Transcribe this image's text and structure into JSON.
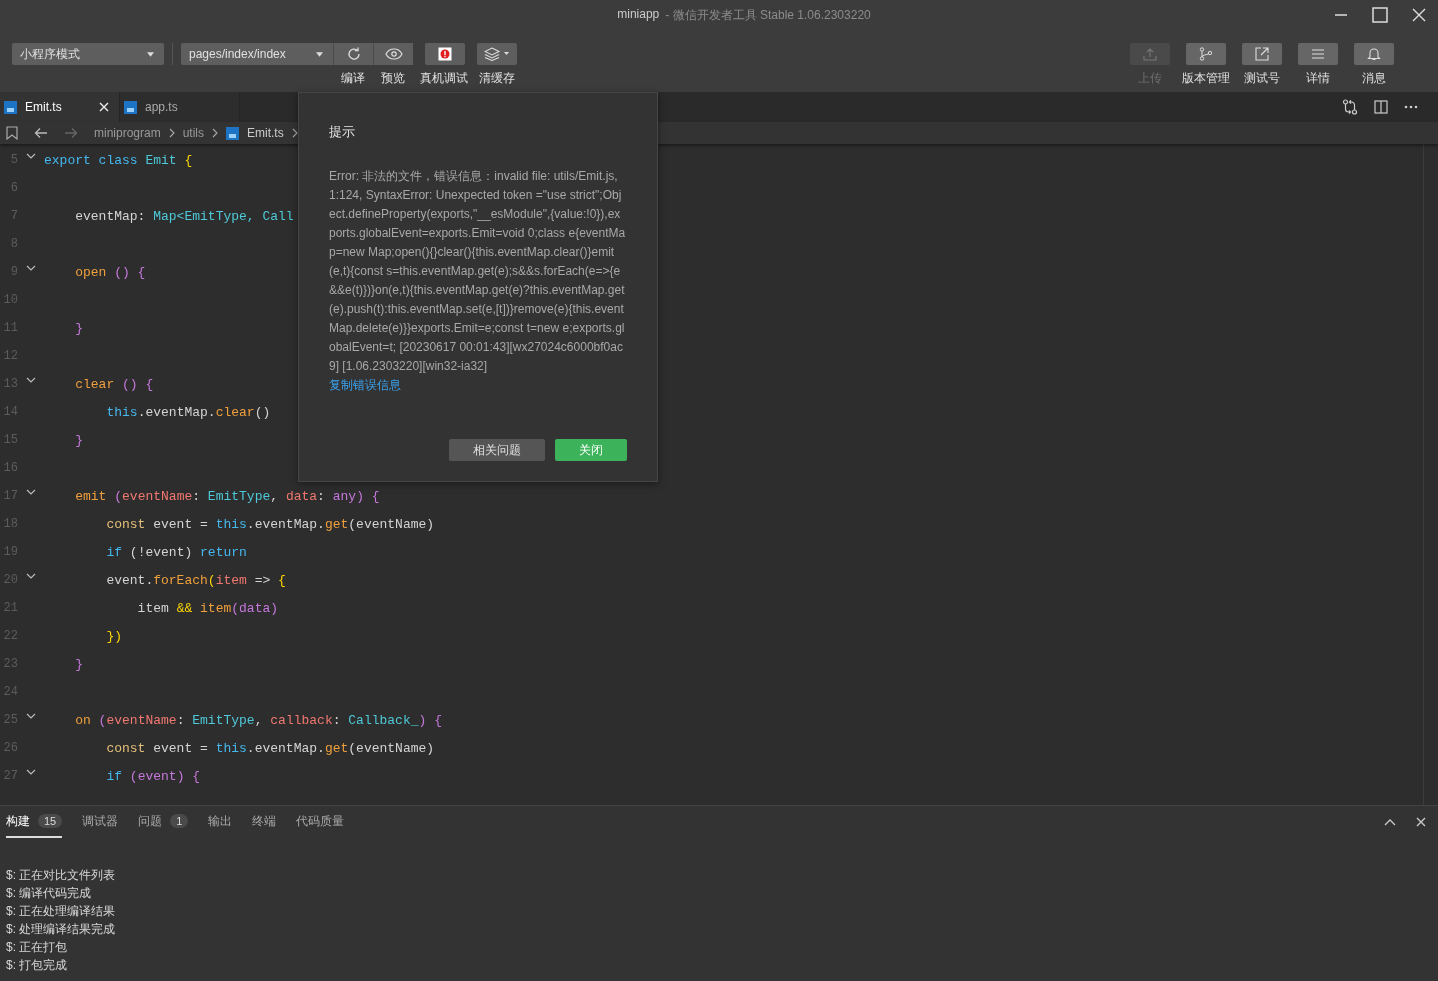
{
  "window": {
    "title": "miniapp",
    "subtitle": "- 微信开发者工具 Stable 1.06.2303220"
  },
  "toolbar": {
    "mode_select": "小程序模式",
    "page_select": "pages/index/index",
    "left_buttons": [
      {
        "label": "编译"
      },
      {
        "label": "预览"
      },
      {
        "label": "真机调试"
      },
      {
        "label": "清缓存"
      }
    ],
    "right_buttons": [
      {
        "label": "上传",
        "disabled": true
      },
      {
        "label": "版本管理",
        "disabled": false
      },
      {
        "label": "测试号",
        "disabled": false
      },
      {
        "label": "详情",
        "disabled": false
      },
      {
        "label": "消息",
        "disabled": false
      }
    ]
  },
  "editor_tabs": [
    {
      "label": "Emit.ts",
      "selected": true
    },
    {
      "label": "app.ts",
      "selected": false
    }
  ],
  "breadcrumb": [
    {
      "label": "miniprogram",
      "kind": "folder"
    },
    {
      "label": "utils",
      "kind": "folder"
    },
    {
      "label": "Emit.ts",
      "kind": "file"
    }
  ],
  "code_lines": [
    {
      "number": "5",
      "foldable": true,
      "tokens": [
        {
          "text": "export class ",
          "kind": "keyword"
        },
        {
          "text": "Emit ",
          "kind": "type"
        },
        {
          "text": "{",
          "kind": "bracket"
        }
      ]
    },
    {
      "number": "6",
      "foldable": false
    },
    {
      "number": "7",
      "foldable": false,
      "tokens": [
        {
          "text": "    eventMap: ",
          "kind": "plain"
        },
        {
          "text": "Map<EmitType, Call",
          "kind": "type"
        }
      ]
    },
    {
      "number": "8",
      "foldable": false
    },
    {
      "number": "9",
      "foldable": true,
      "tokens": [
        {
          "text": "    open ",
          "kind": "function"
        },
        {
          "text": "() {",
          "kind": "paren"
        }
      ]
    },
    {
      "number": "10",
      "foldable": false
    },
    {
      "number": "11",
      "foldable": false,
      "tokens": [
        {
          "text": "    }",
          "kind": "paren"
        }
      ]
    },
    {
      "number": "12",
      "foldable": false
    },
    {
      "number": "13",
      "foldable": true,
      "tokens": [
        {
          "text": "    clear ",
          "kind": "function"
        },
        {
          "text": "() {",
          "kind": "paren"
        }
      ]
    },
    {
      "number": "14",
      "foldable": false,
      "tokens": [
        {
          "text": "        this",
          "kind": "keyword"
        },
        {
          "text": ".eventMap.",
          "kind": "plain"
        },
        {
          "text": "clear",
          "kind": "function"
        },
        {
          "text": "()",
          "kind": "plain"
        }
      ]
    },
    {
      "number": "15",
      "foldable": false,
      "tokens": [
        {
          "text": "    }",
          "kind": "paren"
        }
      ]
    },
    {
      "number": "16",
      "foldable": false
    },
    {
      "number": "17",
      "foldable": true,
      "tokens": [
        {
          "text": "    emit ",
          "kind": "function"
        },
        {
          "text": "(",
          "kind": "paren"
        },
        {
          "text": "eventName",
          "kind": "param"
        },
        {
          "text": ": ",
          "kind": "plain"
        },
        {
          "text": "EmitType",
          "kind": "type"
        },
        {
          "text": ", ",
          "kind": "plain"
        },
        {
          "text": "data",
          "kind": "param"
        },
        {
          "text": ": ",
          "kind": "plain"
        },
        {
          "text": "any",
          "kind": "paren"
        },
        {
          "text": ") {",
          "kind": "paren"
        }
      ]
    },
    {
      "number": "18",
      "foldable": false,
      "tokens": [
        {
          "text": "        const ",
          "kind": "storage"
        },
        {
          "text": "event = ",
          "kind": "plain"
        },
        {
          "text": "this",
          "kind": "keyword"
        },
        {
          "text": ".eventMap.",
          "kind": "plain"
        },
        {
          "text": "get",
          "kind": "function"
        },
        {
          "text": "(eventName)",
          "kind": "plain"
        }
      ]
    },
    {
      "number": "19",
      "foldable": false,
      "tokens": [
        {
          "text": "        if ",
          "kind": "keyword"
        },
        {
          "text": "(!event) ",
          "kind": "plain"
        },
        {
          "text": "return",
          "kind": "keyword"
        }
      ]
    },
    {
      "number": "20",
      "foldable": true,
      "tokens": [
        {
          "text": "        event.",
          "kind": "plain"
        },
        {
          "text": "forEach",
          "kind": "function"
        },
        {
          "text": "(",
          "kind": "bracket"
        },
        {
          "text": "item",
          "kind": "param"
        },
        {
          "text": " => ",
          "kind": "plain"
        },
        {
          "text": "{",
          "kind": "bracket"
        }
      ]
    },
    {
      "number": "21",
      "foldable": false,
      "tokens": [
        {
          "text": "            item ",
          "kind": "plain"
        },
        {
          "text": "&& ",
          "kind": "bracket"
        },
        {
          "text": "item",
          "kind": "function"
        },
        {
          "text": "(data)",
          "kind": "paren"
        }
      ]
    },
    {
      "number": "22",
      "foldable": false,
      "tokens": [
        {
          "text": "        })",
          "kind": "bracket"
        }
      ]
    },
    {
      "number": "23",
      "foldable": false,
      "tokens": [
        {
          "text": "    }",
          "kind": "paren"
        }
      ]
    },
    {
      "number": "24",
      "foldable": false
    },
    {
      "number": "25",
      "foldable": true,
      "tokens": [
        {
          "text": "    on ",
          "kind": "function"
        },
        {
          "text": "(",
          "kind": "paren"
        },
        {
          "text": "eventName",
          "kind": "param"
        },
        {
          "text": ": ",
          "kind": "plain"
        },
        {
          "text": "EmitType",
          "kind": "type"
        },
        {
          "text": ", ",
          "kind": "plain"
        },
        {
          "text": "callback",
          "kind": "param"
        },
        {
          "text": ": ",
          "kind": "plain"
        },
        {
          "text": "Callback_",
          "kind": "type"
        },
        {
          "text": ") {",
          "kind": "paren"
        }
      ]
    },
    {
      "number": "26",
      "foldable": false,
      "tokens": [
        {
          "text": "        const ",
          "kind": "storage"
        },
        {
          "text": "event = ",
          "kind": "plain"
        },
        {
          "text": "this",
          "kind": "keyword"
        },
        {
          "text": ".eventMap.",
          "kind": "plain"
        },
        {
          "text": "get",
          "kind": "function"
        },
        {
          "text": "(eventName)",
          "kind": "plain"
        }
      ]
    },
    {
      "number": "27",
      "foldable": true,
      "tokens": [
        {
          "text": "        if ",
          "kind": "keyword"
        },
        {
          "text": "(event) {",
          "kind": "paren"
        }
      ]
    }
  ],
  "dialog": {
    "title": "提示",
    "message": "Error: 非法的文件，错误信息：invalid file: utils/Emit.js, 1:124, SyntaxError: Unexpected token =\"use strict\";Object.defineProperty(exports,\"__esModule\",{value:!0}),exports.globalEvent=exports.Emit=void 0;class e{eventMap=new Map;open(){}clear(){this.eventMap.clear()}emit(e,t){const s=this.eventMap.get(e);s&&s.forEach(e=>{e&&e(t)})}on(e,t){this.eventMap.get(e)?this.eventMap.get(e).push(t):this.eventMap.set(e,[t])}remove(e){this.eventMap.delete(e)}}exports.Emit=e;const t=new e;exports.globalEvent=t; [20230617 00:01:43][wx27024c6000bf0ac9] [1.06.2303220][win32-ia32]",
    "link": "复制错误信息",
    "buttons": [
      {
        "label": "相关问题",
        "kind": "secondary"
      },
      {
        "label": "关闭",
        "kind": "primary"
      }
    ]
  },
  "bottom_panel": {
    "tabs": [
      {
        "label": "构建",
        "count": "15",
        "selected": true
      },
      {
        "label": "调试器",
        "selected": false
      },
      {
        "label": "问题",
        "count": "1",
        "selected": false
      },
      {
        "label": "输出",
        "selected": false
      },
      {
        "label": "终端",
        "selected": false
      },
      {
        "label": "代码质量",
        "selected": false
      }
    ],
    "log_lines": [
      "$: 正在对比文件列表",
      "$: 编译代码完成",
      "$: 正在处理编译结果",
      "$: 处理编译结果完成",
      "$: 正在打包",
      "$: 打包完成"
    ]
  }
}
